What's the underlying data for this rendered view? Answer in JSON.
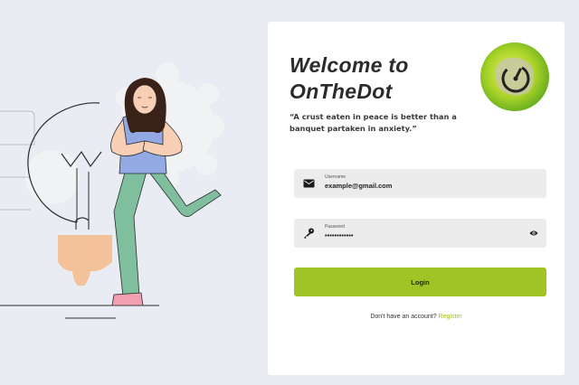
{
  "welcome": {
    "title_line1": "Welcome to",
    "title_line2": "OnTheDot",
    "quote_line1": "“A crust eaten in peace is better than a",
    "quote_line2": "banquet partaken in anxiety.”"
  },
  "form": {
    "username_label": "Username",
    "username_value": "example@gmail.com",
    "password_label": "Password",
    "password_value": "••••••••••••",
    "login_label": "Login"
  },
  "footer": {
    "prompt": "Don't have an account?",
    "register_link": "Register"
  },
  "colors": {
    "accent": "#a0c326",
    "background": "#e9edf3",
    "card": "#ffffff",
    "field": "#ececec"
  },
  "icons": {
    "logo": "timer-icon",
    "username": "mail-icon",
    "password": "key-icon",
    "toggle": "eye-icon"
  }
}
